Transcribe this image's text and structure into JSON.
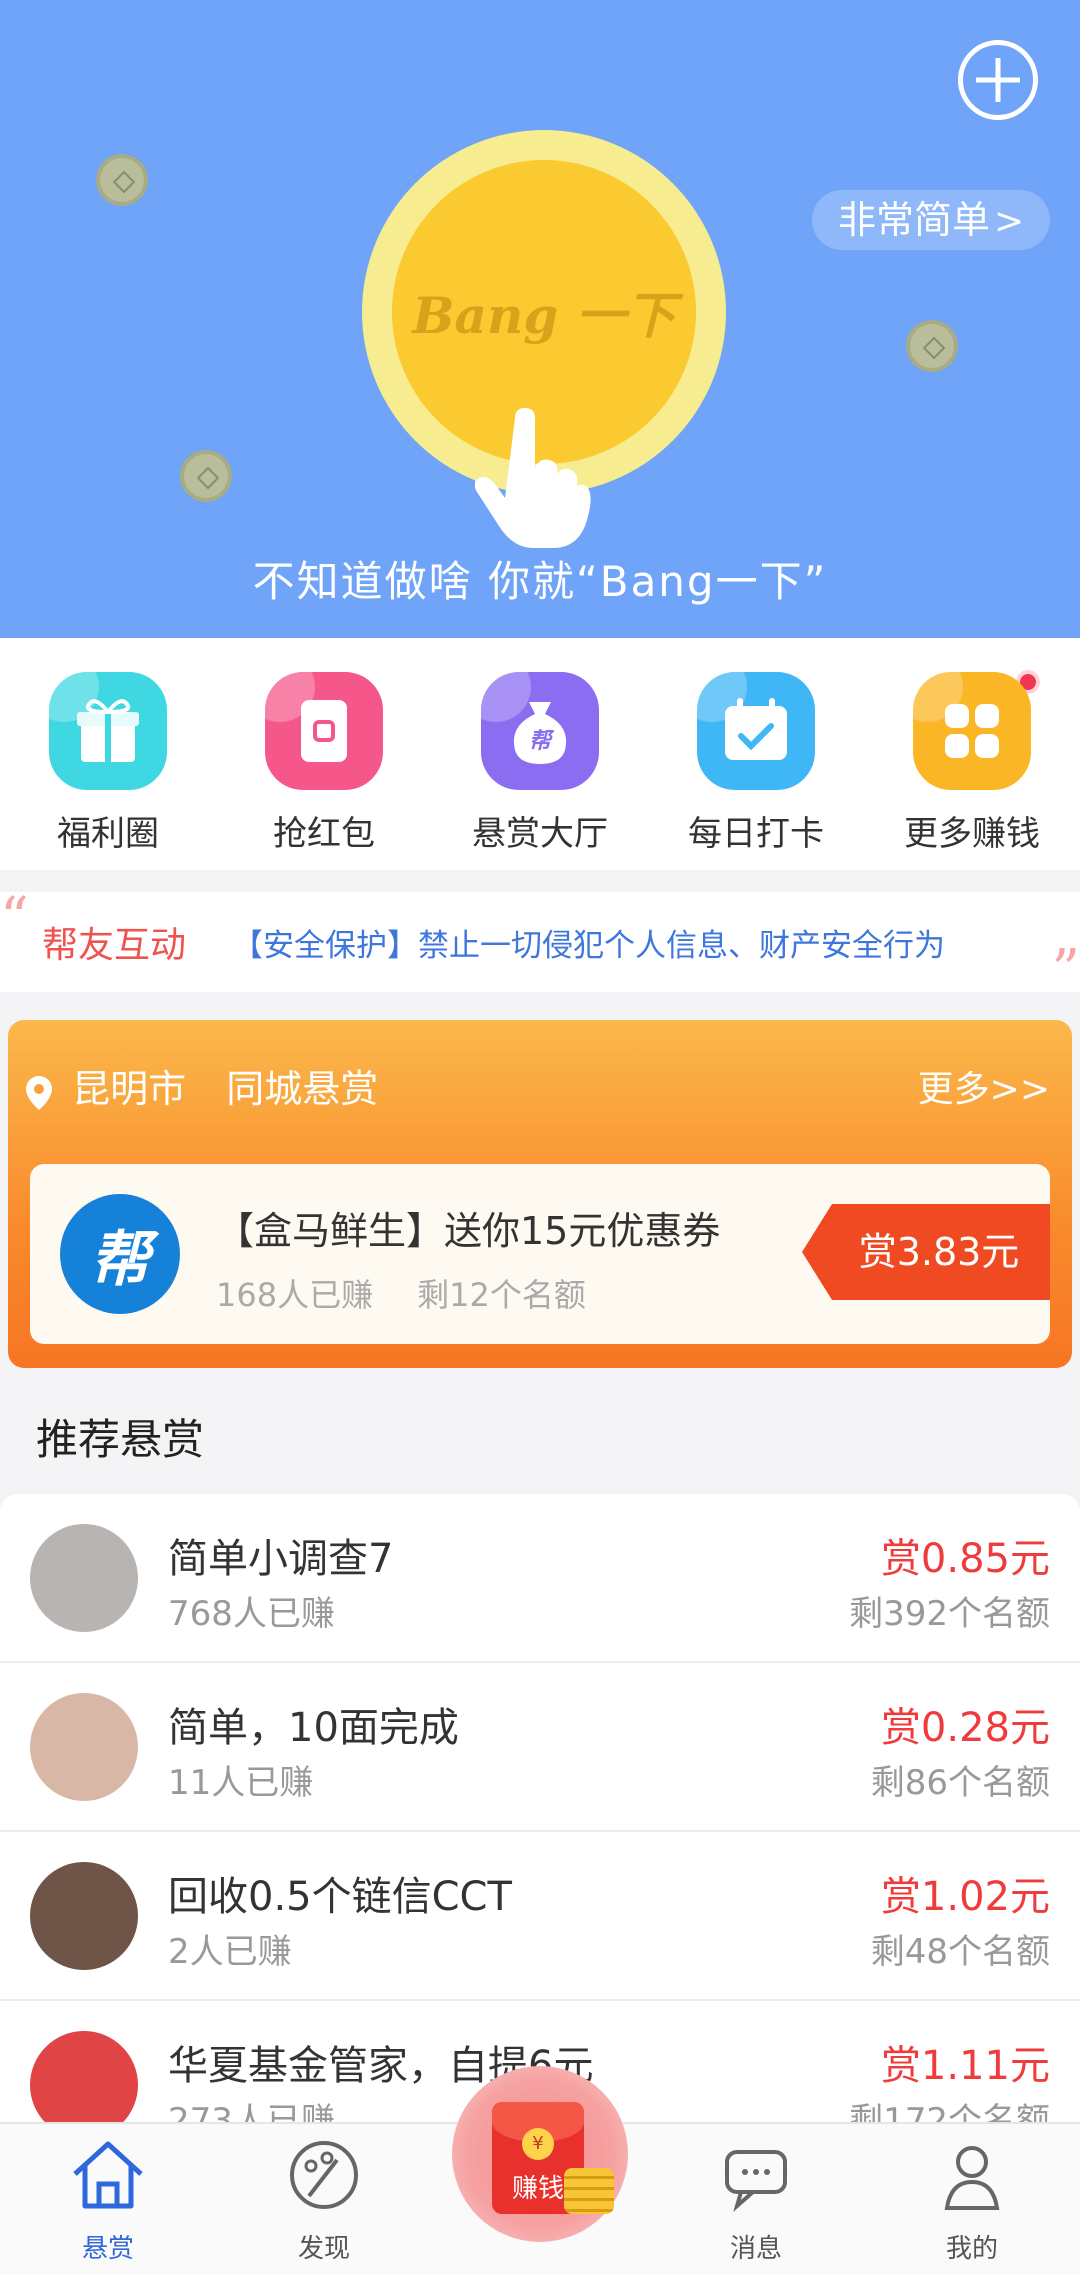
{
  "hero": {
    "pill_label": "非常简单",
    "pill_chevron": ">",
    "coin_text": "Bang 一下",
    "caption": "不知道做啥 你就“Bang一下”"
  },
  "quick_actions": [
    {
      "label": "福利圈",
      "color": "#3ed7e2",
      "icon": "gift-icon"
    },
    {
      "label": "抢红包",
      "color": "#f5578a",
      "icon": "red-packet-icon"
    },
    {
      "label": "悬赏大厅",
      "color": "#8b6df1",
      "icon": "money-bag-icon"
    },
    {
      "label": "每日打卡",
      "color": "#3fb6f5",
      "icon": "calendar-check-icon"
    },
    {
      "label": "更多赚钱",
      "color": "#fbb626",
      "icon": "grid-icon"
    }
  ],
  "notice": {
    "title": "帮友互动",
    "text": "【安全保护】禁止一切侵犯个人信息、财产安全行为"
  },
  "local": {
    "city": "昆明市",
    "section": "同城悬赏",
    "more": "更多>>",
    "logo": "帮",
    "card": {
      "title": "【盒马鲜生】送你15元优惠券",
      "earned": "168人已赚",
      "remaining": "剩12个名额",
      "reward": "赏3.83元"
    }
  },
  "recommend": {
    "title": "推荐悬赏",
    "items": [
      {
        "title": "简单小调查7",
        "earned": "768人已赚",
        "reward": "赏0.85元",
        "remaining": "剩392个名额",
        "avatar_color": "#b8b4b2"
      },
      {
        "title": "简单，10面完成",
        "earned": "11人已赚",
        "reward": "赏0.28元",
        "remaining": "剩86个名额",
        "avatar_color": "#d9b7a6"
      },
      {
        "title": "回收0.5个链信CCT",
        "earned": "2人已赚",
        "reward": "赏1.02元",
        "remaining": "剩48个名额",
        "avatar_color": "#6e5548"
      },
      {
        "title": "华夏基金管家，自提6元",
        "earned": "273人已赚",
        "reward": "赏1.11元",
        "remaining": "剩172个名额",
        "avatar_color": "#e04444"
      }
    ]
  },
  "tabbar": {
    "tabs": [
      {
        "label": "悬赏",
        "icon": "home-icon",
        "active": true
      },
      {
        "label": "发现",
        "icon": "palette-icon",
        "active": false
      },
      {
        "label": "消息",
        "icon": "chat-icon",
        "active": false
      },
      {
        "label": "我的",
        "icon": "user-icon",
        "active": false
      }
    ],
    "center_label": "赚钱",
    "center_coin": "¥"
  }
}
